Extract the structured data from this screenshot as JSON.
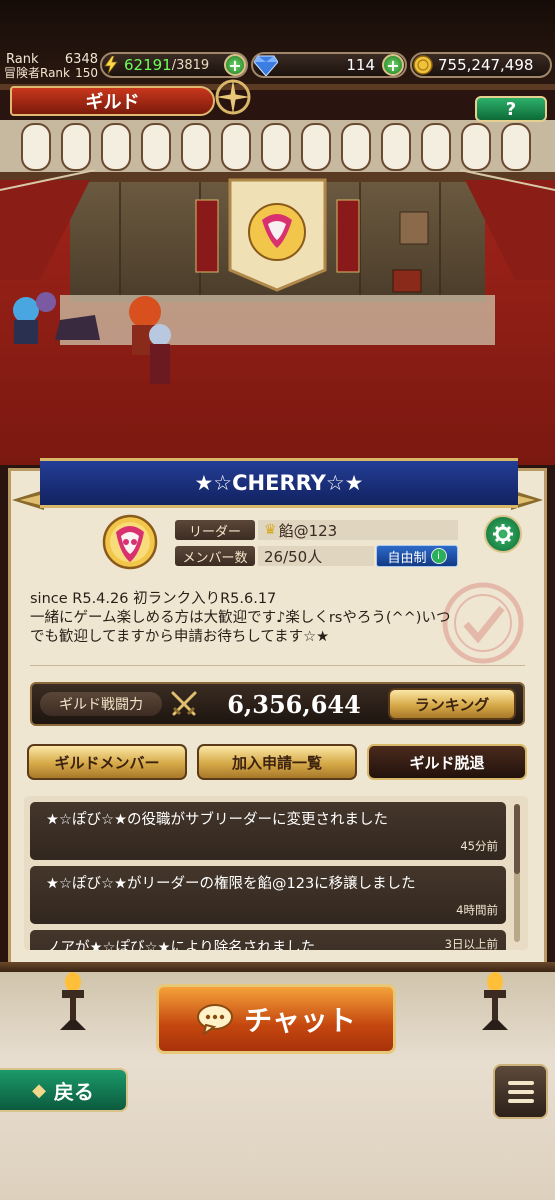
{
  "status": {
    "rank_label": "Rank",
    "rank_value": "6348",
    "adv_rank_label": "冒険者Rank",
    "adv_rank_value": "150",
    "stamina_current": "62191",
    "stamina_max": "/3819",
    "gems": "114",
    "gold": "755,247,498"
  },
  "header": {
    "title": "ギルド",
    "help": "?"
  },
  "guild": {
    "name": "★☆CHERRY☆★",
    "leader_label": "リーダー",
    "leader_name": "餡@123",
    "members_label": "メンバー数",
    "members_value": "26/50人",
    "join_mode": "自由制",
    "description_lines": [
      "since R5.4.26  初ランク入りR5.6.17",
      "一緒にゲーム楽しめる方は大歓迎です♪楽しくrsやろう(^^)いつ",
      "でも歓迎してますから申請お待ちしてます☆★"
    ],
    "power_label": "ギルド戦闘力",
    "power_value": "6,356,644",
    "ranking_button": "ランキング"
  },
  "actions": {
    "members_button": "ギルドメンバー",
    "requests_button": "加入申請一覧",
    "leave_button": "ギルド脱退"
  },
  "log": [
    {
      "text": "★☆ぽび☆★の役職がサブリーダーに変更されました",
      "time": "45分前"
    },
    {
      "text": "★☆ぽび☆★がリーダーの権限を餡@123に移譲しました",
      "time": "4時間前"
    },
    {
      "text": "ノアが★☆ぽび☆★により除名されました",
      "time": "3日以上前"
    }
  ],
  "bottom": {
    "chat_button": "チャット",
    "back_button": "戻る"
  },
  "colors": {
    "stamina": "#6dff5a",
    "ribbon": "#1d3480",
    "accent_gold": "#d8b768",
    "chat_orange": "#e0701e"
  }
}
